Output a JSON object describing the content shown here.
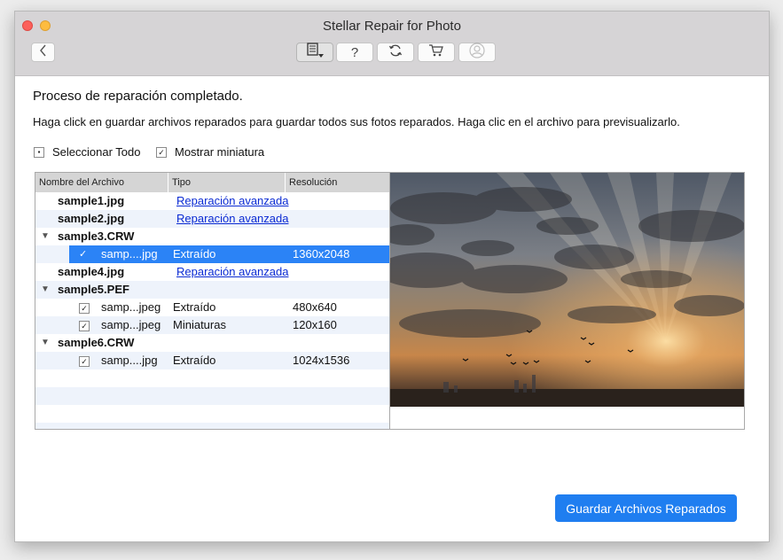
{
  "window": {
    "title": "Stellar Repair for Photo"
  },
  "toolbar": {
    "back": "back-arrow-icon",
    "icons": [
      "save-menu-icon",
      "help-icon",
      "refresh-icon",
      "cart-icon",
      "account-icon"
    ],
    "help_label": "?"
  },
  "main": {
    "heading": "Proceso de reparación completado.",
    "instructions": "Haga click en guardar archivos reparados para guardar todos sus fotos reparados. Haga clic en el archivo para previsualizarlo.",
    "select_all": "Seleccionar Todo",
    "show_thumbnail": "Mostrar miniatura"
  },
  "table": {
    "columns": [
      "Nombre del Archivo",
      "Tipo",
      "Resolución"
    ],
    "rows": [
      {
        "name": "sample1.jpg",
        "type": "Reparación avanzada",
        "resolution": ""
      },
      {
        "name": "sample2.jpg",
        "type": "Reparación avanzada",
        "resolution": ""
      },
      {
        "name": "sample3.CRW",
        "type": "",
        "resolution": ""
      },
      {
        "name": "samp....jpg",
        "type": "Extraído",
        "resolution": "1360x2048"
      },
      {
        "name": "sample4.jpg",
        "type": "Reparación avanzada",
        "resolution": ""
      },
      {
        "name": "sample5.PEF",
        "type": "",
        "resolution": ""
      },
      {
        "name": "samp...jpeg",
        "type": "Extraído",
        "resolution": "480x640"
      },
      {
        "name": "samp...jpeg",
        "type": "Miniaturas",
        "resolution": "120x160"
      },
      {
        "name": "sample6.CRW",
        "type": "",
        "resolution": ""
      },
      {
        "name": "samp....jpg",
        "type": "Extraído",
        "resolution": "1024x1536"
      }
    ],
    "check": "✓",
    "expand": "▼"
  },
  "actions": {
    "save_label": "Guardar Archivos Reparados"
  },
  "colors": {
    "accent": "#2b83f6",
    "button": "#1f7ef0",
    "link": "#0b2bd3"
  }
}
